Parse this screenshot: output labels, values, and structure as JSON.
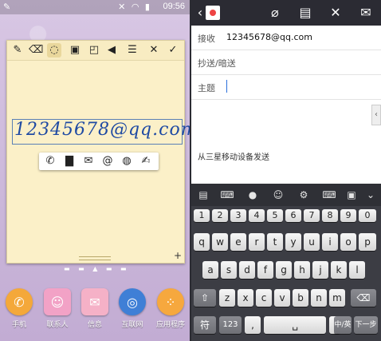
{
  "left": {
    "status": {
      "time": "09:56"
    },
    "handwriting": "12345678@qq.com",
    "dock": [
      {
        "label": "手机",
        "color": "#f4a83a"
      },
      {
        "label": "联系人",
        "color": "#f2a2c6"
      },
      {
        "label": "信息",
        "color": "#f5b1c7"
      },
      {
        "label": "互联网",
        "color": "#3f7fd6"
      },
      {
        "label": "应用程序",
        "color": "#f6a83e"
      }
    ]
  },
  "right": {
    "to": {
      "label": "接收",
      "value": "12345678@qq.com"
    },
    "cc": {
      "label": "抄送/暗送"
    },
    "subject": {
      "label": "主题"
    },
    "signature": "从三星移动设备发送",
    "keyboard": {
      "numbers": [
        "1",
        "2",
        "3",
        "4",
        "5",
        "6",
        "7",
        "8",
        "9",
        "0"
      ],
      "row1": [
        "q",
        "w",
        "e",
        "r",
        "t",
        "y",
        "u",
        "i",
        "o",
        "p"
      ],
      "row2": [
        "a",
        "s",
        "d",
        "f",
        "g",
        "h",
        "j",
        "k",
        "l"
      ],
      "row3": [
        "z",
        "x",
        "c",
        "v",
        "b",
        "n",
        "m"
      ],
      "bottom": {
        "symbols": "符",
        "num123": "123",
        "lang": "中/英",
        "next": "下一步"
      }
    }
  }
}
